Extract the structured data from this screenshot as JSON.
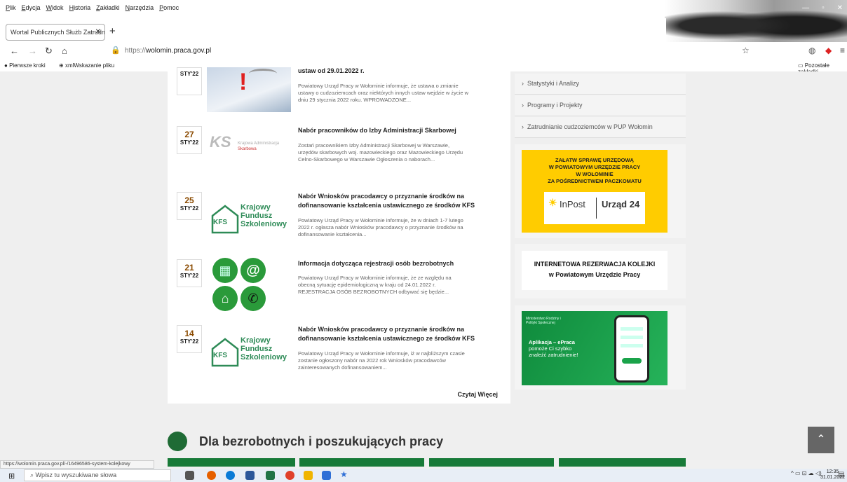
{
  "menubar": {
    "items": [
      "Plik",
      "Edycja",
      "Widok",
      "Historia",
      "Zakładki",
      "Narzędzia",
      "Pomoc"
    ]
  },
  "tab": {
    "title": "Wortal Publicznych Służb Zatrudnie"
  },
  "nav": {
    "url_prefix": "https://",
    "url_domain": "wolomin.praca.gov.pl"
  },
  "bookmarks": {
    "first": "Pierwsze kroki",
    "second": "xmlWskazanie pliku",
    "other": "Pozostałe zakładki"
  },
  "news": [
    {
      "day": "",
      "month": "STY'22",
      "title": "ustaw od 29.01.2022 r.",
      "excerpt": "Powiatowy Urząd Pracy w Wołominie informuje, że ustawa o zmianie ustawy o cudzoziemcach oraz niektórych innych ustaw wejdzie w życie w dniu 29 stycznia 2022 roku. WPROWADZONE...",
      "thumb": "laptop-warning"
    },
    {
      "day": "27",
      "month": "STY'22",
      "title": "Nabór pracowników do Izby Administracji Skarbowej",
      "excerpt": "Zostań pracownikiem Izby Administracji Skarbowej w Warszawie, urzędów skarbowych woj. mazowieckiego oraz Mazowieckiego Urzędu Celno-Skarbowego w Warszawie Ogłoszenia o naborach...",
      "thumb": "kas-logo",
      "logo_line1": "Krajowa Administracja",
      "logo_line2": "Skarbowa"
    },
    {
      "day": "25",
      "month": "STY'22",
      "title": "Nabór Wniosków pracodawcy o przyznanie środków na dofinansowanie kształcenia ustawicznego ze środków KFS",
      "excerpt": "Powiatowy Urząd Pracy w Wołominie informuje, że w dniach 1-7 lutego  2022 r. ogłasza nabór Wniosków pracodawcy o przyznanie środków na dofinansowanie kształcenia...",
      "thumb": "kfs-logo"
    },
    {
      "day": "21",
      "month": "STY'22",
      "title": "Informacja dotycząca rejestracji osób bezrobotnych",
      "excerpt": "Powiatowy Urząd Pracy w Wołominie informuje, że ze względu na obecną sytuację epidemiologiczną w kraju od 24.01.2022 r. REJESTRACJA OSÓB BEZROBOTNYCH odbywać się będzie...",
      "thumb": "contact-icons"
    },
    {
      "day": "14",
      "month": "STY'22",
      "title": "Nabór Wniosków pracodawcy o przyznanie środków na dofinansowanie kształcenia ustawicznego ze środków KFS",
      "excerpt": "  Powiatowy Urząd  Pracy w Wołominie informuje, iż w najbliższym czasie zostanie ogłoszony nabór na 2022 rok Wniosków pracodawców zainteresowanych dofinansowaniem...",
      "thumb": "kfs-logo"
    }
  ],
  "kfs": {
    "abbr": "KFS",
    "line1": "Krajowy",
    "line2": "Fundusz",
    "line3": "Szkoleniowy"
  },
  "more_label": "Czytaj Więcej",
  "sidebar": {
    "items": [
      "Statystyki i Analizy",
      "Programy i Projekty",
      "Zatrudnianie cudzoziemców w PUP Wołomin"
    ],
    "paczkomat": {
      "line1": "ZAŁATW SPRAWĘ URZĘDOWĄ",
      "line2": "W POWIATOWYM URZĘDZIE PRACY",
      "line3": "W WOŁOMINIE",
      "line4": "ZA POŚREDNICTWEM PACZKOMATU",
      "inpost": "InPost",
      "urzad": "Urząd 24"
    },
    "kolejka": {
      "line1": "INTERNETOWA REZERWACJA KOLEJKI",
      "line2": "w Powiatowym Urzędzie Pracy"
    },
    "epraca": {
      "ministry": "Ministerstwo Rodziny i Polityki Społecznej",
      "line1": "Aplikacja – ePraca",
      "line2": "pomoże Ci szybko",
      "line3": "znaleźć zatrudnienie!"
    }
  },
  "section_title": "Dla bezrobotnych i poszukujących pracy",
  "status_url": "https://wolomin.praca.gov.pl/-/16496586-system-kolejkowy",
  "taskbar": {
    "search_placeholder": "Wpisz tu wyszukiwane słowa",
    "time": "12:35",
    "date": "31.01.2022"
  },
  "colors": {
    "green": "#1f6b35",
    "inpost_yellow": "#ffcc00",
    "epraca_green": "#1aa34a"
  }
}
